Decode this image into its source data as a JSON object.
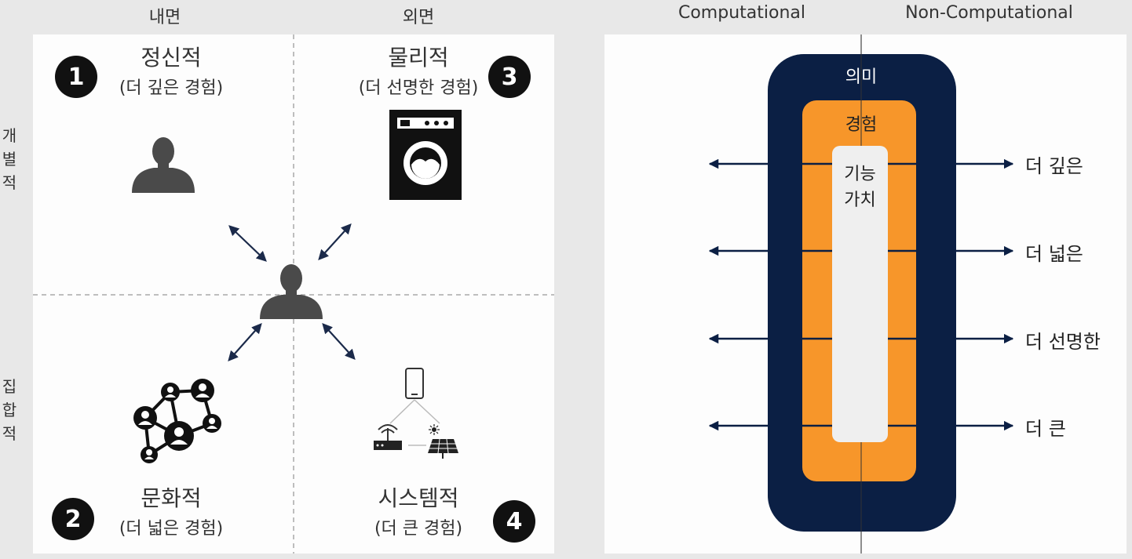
{
  "left_diagram": {
    "col_headers": [
      "내면",
      "외면"
    ],
    "row_headers": [
      "개별적",
      "집합적"
    ],
    "quadrants": [
      {
        "badge": "1",
        "title": "정신적",
        "subtitle": "(더 깊은 경험)",
        "icon": "person-icon"
      },
      {
        "badge": "2",
        "title": "문화적",
        "subtitle": "(더 넓은 경험)",
        "icon": "network-icon"
      },
      {
        "badge": "3",
        "title": "물리적",
        "subtitle": "(더 선명한 경험)",
        "icon": "washing-machine-icon"
      },
      {
        "badge": "4",
        "title": "시스템적",
        "subtitle": "(더 큰 경험)",
        "icon": "iot-system-icon"
      }
    ],
    "center_icon": "person-icon"
  },
  "right_diagram": {
    "col_headers": [
      "Computational",
      "Non-Computational"
    ],
    "layers": {
      "outer": "의미",
      "middle": "경험",
      "inner_line1": "기능",
      "inner_line2": "가치"
    },
    "arrow_labels": [
      "더 깊은",
      "더 넓은",
      "더 선명한",
      "더 큰"
    ],
    "colors": {
      "outer": "#0b1f44",
      "middle": "#f7962a",
      "inner": "#efefef",
      "arrow": "#0b1f44"
    }
  }
}
